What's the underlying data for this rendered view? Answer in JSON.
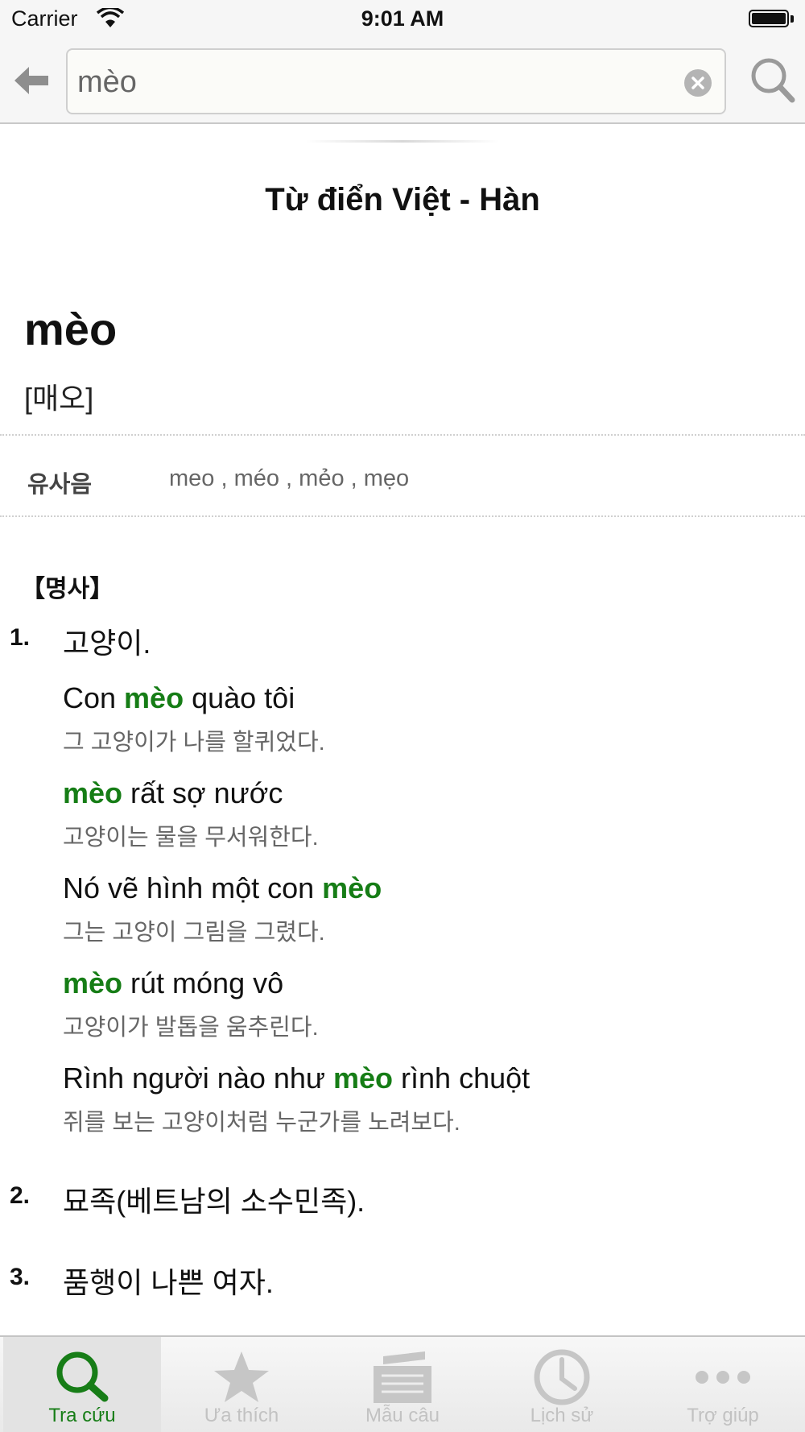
{
  "status_bar": {
    "carrier": "Carrier",
    "time": "9:01 AM"
  },
  "search": {
    "value": "mèo"
  },
  "dictionary_title": "Từ điển Việt - Hàn",
  "entry": {
    "headword": "mèo",
    "pronunciation": "[매오]",
    "similar_label": "유사음",
    "similar_words": "meo , méo , mẻo , mẹo",
    "pos": "【명사】",
    "senses": [
      {
        "num": "1.",
        "text": "고양이.",
        "examples": [
          {
            "vi_before": "Con ",
            "vi_hl": "mèo",
            "vi_after": " quào tôi",
            "ko": "그 고양이가 나를 할퀴었다."
          },
          {
            "vi_before": "",
            "vi_hl": "mèo",
            "vi_after": " rất sợ nước",
            "ko": "고양이는 물을 무서워한다."
          },
          {
            "vi_before": "Nó vẽ hình một con ",
            "vi_hl": "mèo",
            "vi_after": "",
            "ko": "그는 고양이 그림을 그렸다."
          },
          {
            "vi_before": "",
            "vi_hl": "mèo",
            "vi_after": " rút móng vô",
            "ko": "고양이가 발톱을 움추린다."
          },
          {
            "vi_before": "Rình người nào như ",
            "vi_hl": "mèo",
            "vi_after": " rình chuột",
            "ko": "쥐를 보는 고양이처럼 누군가를 노려보다."
          }
        ]
      },
      {
        "num": "2.",
        "text": "묘족(베트남의 소수민족)."
      },
      {
        "num": "3.",
        "text": "품행이 나쁜 여자."
      }
    ]
  },
  "tabs": [
    {
      "label": "Tra cứu",
      "icon": "search-icon",
      "selected": true
    },
    {
      "label": "Ưa thích",
      "icon": "star-icon",
      "selected": false
    },
    {
      "label": "Mẫu câu",
      "icon": "notes-icon",
      "selected": false
    },
    {
      "label": "Lịch sử",
      "icon": "clock-icon",
      "selected": false
    },
    {
      "label": "Trợ giúp",
      "icon": "more-icon",
      "selected": false
    }
  ],
  "colors": {
    "accent": "#177d17",
    "highlight": "#167d16",
    "tab_inactive": "#c2c2c2"
  }
}
